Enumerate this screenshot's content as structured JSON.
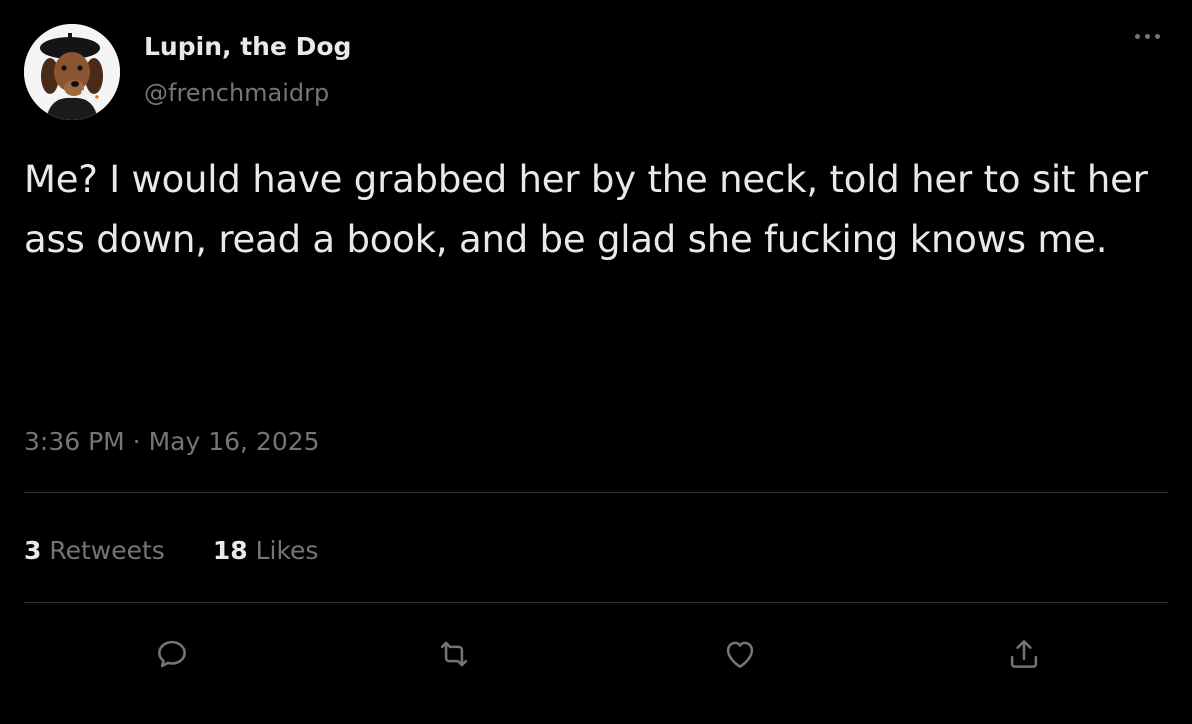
{
  "author": {
    "display_name": "Lupin, the Dog",
    "handle": "@frenchmaidrp",
    "avatar_icon": "dachshund-beret-avatar"
  },
  "tweet": {
    "text": "Me? I would have grabbed her by the neck, told her to sit her ass down, read a book, and be glad she fucking knows me.",
    "timestamp": "3:36 PM · May 16, 2025"
  },
  "stats": {
    "retweets_count": "3",
    "retweets_label": "Retweets",
    "likes_count": "18",
    "likes_label": "Likes"
  },
  "actions": {
    "icons": [
      "reply-icon",
      "retweet-icon",
      "like-icon",
      "share-icon"
    ]
  },
  "colors": {
    "background": "#000000",
    "primary_text": "#e7e9ea",
    "secondary_text": "#71767b",
    "divider": "#2f3336"
  }
}
